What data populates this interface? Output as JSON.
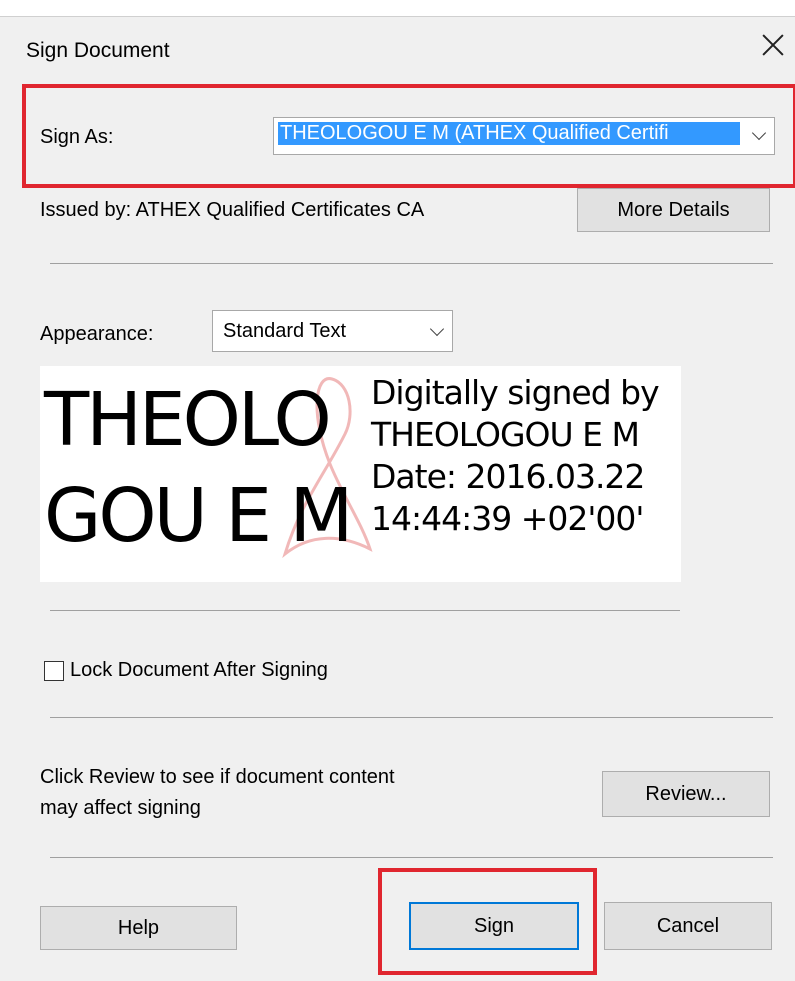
{
  "dialog": {
    "title": "Sign Document"
  },
  "sign_as": {
    "label": "Sign As:",
    "value": "THEOLOGOU E M (ATHEX Qualified Certifi"
  },
  "issued_by": "Issued by: ATHEX Qualified Certificates CA",
  "more_details_label": "More Details",
  "appearance": {
    "label": "Appearance:",
    "value": "Standard Text"
  },
  "preview": {
    "name_line1": "THEOLO",
    "name_line2": "GOU E M",
    "info_lines": [
      "Digitally signed by",
      "THEOLOGOU E M",
      "Date: 2016.03.22",
      "14:44:39 +02'00'"
    ]
  },
  "lock": {
    "label": "Lock Document After Signing",
    "checked": false
  },
  "review": {
    "text_line1": "Click Review to see if document content",
    "text_line2": "may affect signing",
    "button_label": "Review..."
  },
  "buttons": {
    "help": "Help",
    "sign": "Sign",
    "cancel": "Cancel"
  },
  "colors": {
    "highlight_box": "#e0262f",
    "selection": "#3399ff",
    "primary_border": "#0078d7",
    "dialog_bg": "#f0f0f0"
  }
}
